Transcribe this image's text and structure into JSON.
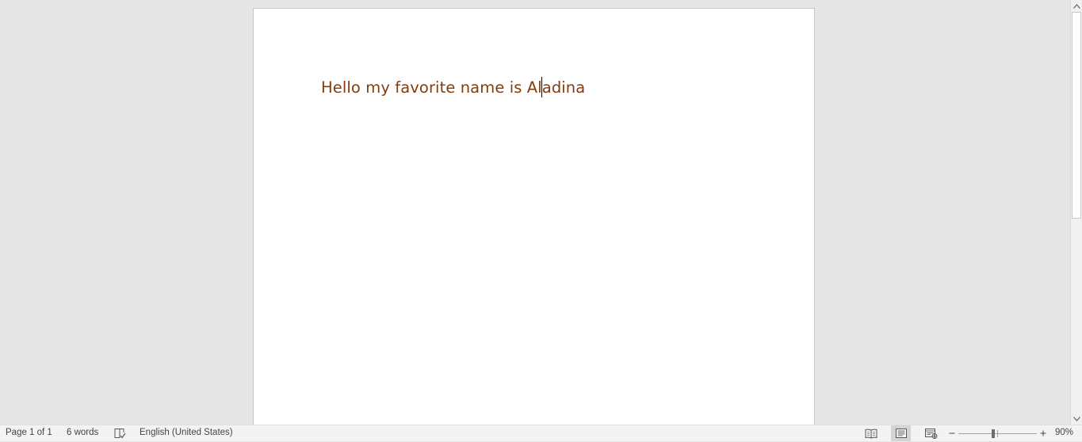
{
  "document": {
    "text_before_caret": "Hello my favorite name is Al",
    "text_after_caret": "adina",
    "text_color": "#843c0c"
  },
  "status_bar": {
    "page_count": "Page 1 of 1",
    "word_count": "6 words",
    "proofing_icon": "proofing-check-icon",
    "language": "English (United States)",
    "views": [
      {
        "name": "read-mode",
        "icon": "book-icon",
        "active": false
      },
      {
        "name": "print-layout",
        "icon": "page-icon",
        "active": true
      },
      {
        "name": "web-layout",
        "icon": "web-icon",
        "active": false
      }
    ],
    "zoom_out": "zoom-out-icon",
    "zoom_in": "zoom-in-icon",
    "zoom_level": "90%",
    "zoom_percent": 90
  },
  "colors": {
    "canvas": "#e6e6e6",
    "page": "#ffffff",
    "statusbar": "#f3f3f3",
    "active_view": "#d4d4d4"
  }
}
